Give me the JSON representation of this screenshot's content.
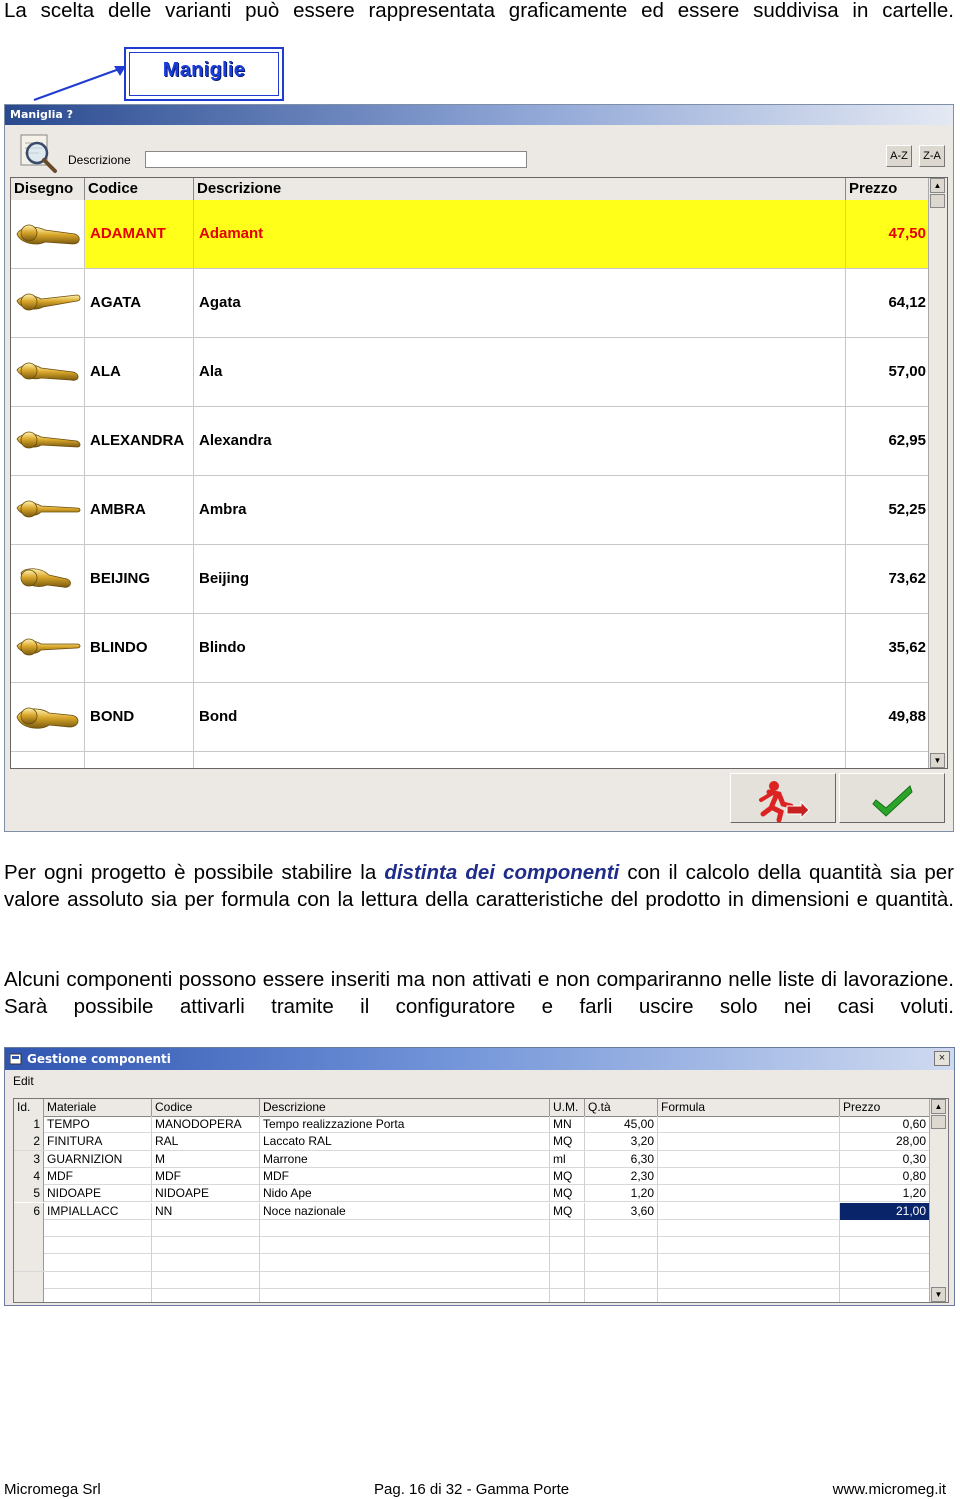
{
  "intro": "La scelta delle varianti può essere rappresentata graficamente ed essere suddivisa in cartelle.",
  "callout_label": "Maniglie",
  "window1": {
    "title": "Maniglia ?",
    "description_label": "Descrizione",
    "description_value": "",
    "sort_az": "A-Z",
    "sort_za": "Z-A",
    "columns": [
      "Disegno",
      "Codice",
      "Descrizione",
      "Prezzo"
    ],
    "rows": [
      {
        "codice": "ADAMANT",
        "descrizione": "Adamant",
        "prezzo": "47,50",
        "selected": true
      },
      {
        "codice": "AGATA",
        "descrizione": "Agata",
        "prezzo": "64,12"
      },
      {
        "codice": "ALA",
        "descrizione": "Ala",
        "prezzo": "57,00"
      },
      {
        "codice": "ALEXANDRA",
        "descrizione": "Alexandra",
        "prezzo": "62,95"
      },
      {
        "codice": "AMBRA",
        "descrizione": "Ambra",
        "prezzo": "52,25"
      },
      {
        "codice": "BEIJING",
        "descrizione": "Beijing",
        "prezzo": "73,62"
      },
      {
        "codice": "BLINDO",
        "descrizione": "Blindo",
        "prezzo": "35,62"
      },
      {
        "codice": "BOND",
        "descrizione": "Bond",
        "prezzo": "49,88"
      }
    ]
  },
  "para2": {
    "before": "Per ogni progetto è possibile stabilire la ",
    "highlight": "distinta dei componenti",
    "after": " con il calcolo della quantità sia per valore assoluto sia per formula con la lettura della caratteristiche del prodotto in dimensioni e quantità."
  },
  "para3": "Alcuni componenti possono essere inseriti ma non attivati e non compariranno nelle liste di lavorazione. Sarà possibile attivarli tramite il configuratore e farli uscire solo nei casi voluti.",
  "window2": {
    "title": "Gestione componenti",
    "menu_edit": "Edit",
    "close": "×",
    "columns": [
      "Id.",
      "Materiale",
      "Codice",
      "Descrizione",
      "U.M.",
      "Q.tà",
      "Formula",
      "Prezzo"
    ],
    "rows": [
      {
        "id": "1",
        "materiale": "TEMPO",
        "codice": "MANODOPERA",
        "descrizione": "Tempo realizzazione Porta",
        "um": "MN",
        "qta": "45,00",
        "formula": "",
        "prezzo": "0,60"
      },
      {
        "id": "2",
        "materiale": "FINITURA",
        "codice": "RAL",
        "descrizione": "Laccato RAL",
        "um": "MQ",
        "qta": "3,20",
        "formula": "",
        "prezzo": "28,00"
      },
      {
        "id": "3",
        "materiale": "GUARNIZION",
        "codice": "M",
        "descrizione": "Marrone",
        "um": "ml",
        "qta": "6,30",
        "formula": "",
        "prezzo": "0,30"
      },
      {
        "id": "4",
        "materiale": "MDF",
        "codice": "MDF",
        "descrizione": "MDF",
        "um": "MQ",
        "qta": "2,30",
        "formula": "",
        "prezzo": "0,80"
      },
      {
        "id": "5",
        "materiale": "NIDOAPE",
        "codice": "NIDOAPE",
        "descrizione": "Nido Ape",
        "um": "MQ",
        "qta": "1,20",
        "formula": "",
        "prezzo": "1,20"
      },
      {
        "id": "6",
        "materiale": "IMPIALLACC",
        "codice": "NN",
        "descrizione": "Noce nazionale",
        "um": "MQ",
        "qta": "3,60",
        "formula": "",
        "prezzo": "21,00",
        "selected_price": true
      }
    ]
  },
  "footer": {
    "left": "Micromega Srl",
    "center": "Pag. 16 di 32 - Gamma Porte",
    "right": "www.micromeg.it"
  }
}
